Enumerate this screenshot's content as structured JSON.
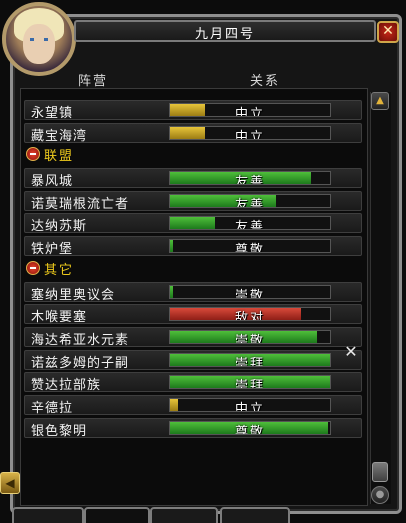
{
  "window": {
    "title": "九月四号",
    "close_icon": "close-icon"
  },
  "columns": {
    "faction": "阵营",
    "standing": "关系"
  },
  "rows_top": [
    {
      "name": "永望镇",
      "standing": "中立",
      "color": "#d6b22c",
      "level": 0.22,
      "bar": "yellow"
    },
    {
      "name": "藏宝海湾",
      "standing": "中立",
      "color": "#d6b22c",
      "level": 0.22,
      "bar": "yellow"
    }
  ],
  "category_alliance": "联盟",
  "rows_alliance": [
    {
      "name": "暴风城",
      "standing": "友善",
      "level": 0.88,
      "bar": "green"
    },
    {
      "name": "诺莫瑞根流亡者",
      "standing": "友善",
      "level": 0.66,
      "bar": "green"
    },
    {
      "name": "达纳苏斯",
      "standing": "友善",
      "level": 0.28,
      "bar": "green"
    },
    {
      "name": "铁炉堡",
      "standing": "尊敬",
      "level": 0.02,
      "bar": "green"
    }
  ],
  "category_other": "其它",
  "rows_other": [
    {
      "name": "塞纳里奥议会",
      "standing": "崇敬",
      "level": 0.02,
      "bar": "green"
    },
    {
      "name": "木喉要塞",
      "standing": "敌对",
      "level": 0.82,
      "bar": "red"
    },
    {
      "name": "海达希亚水元素",
      "standing": "崇敬",
      "level": 0.92,
      "bar": "green"
    },
    {
      "name": "诺兹多姆的子嗣",
      "standing": "崇拜",
      "level": 1.0,
      "bar": "green"
    },
    {
      "name": "赞达拉部族",
      "standing": "崇拜",
      "level": 1.0,
      "bar": "green"
    },
    {
      "name": "辛德拉",
      "standing": "中立",
      "level": 0.05,
      "bar": "yellow"
    },
    {
      "name": "银色黎明",
      "standing": "尊敬",
      "level": 0.99,
      "bar": "green"
    }
  ],
  "tabs": [
    "",
    "",
    "",
    ""
  ],
  "icons": {
    "war": "crossed-swords-icon",
    "horn": "horn-icon",
    "scroll_up": "scroll-up-icon",
    "scroll_down": "scroll-down-icon"
  }
}
